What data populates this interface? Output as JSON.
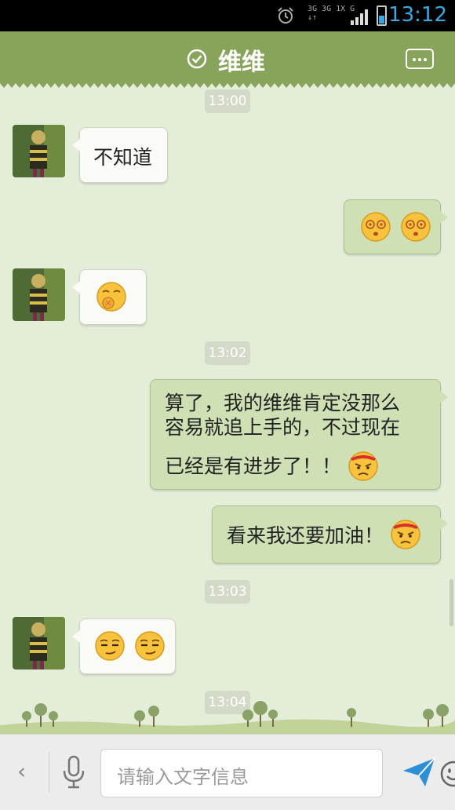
{
  "status_bar": {
    "time": "13:12",
    "network_line1": "3G 3G 1X G",
    "network_line2": "↓↑  ",
    "accent": "#37a9e0"
  },
  "header": {
    "title": "维维",
    "check_icon": "check-circle-icon",
    "more_icon": "more-icon",
    "color": "#88a35a"
  },
  "messages": {
    "t1": "13:00",
    "m1_text": "不知道",
    "t2": "13:02",
    "m5_line1": "算了，我的维维肯定没那么",
    "m5_line2": "容易就追上手的，不过现在",
    "m5_line3": "已经是有进步了！！",
    "m6_text": "看来我还要加油！",
    "t3": "13:03",
    "t4": "13:04"
  },
  "input": {
    "placeholder": "请输入文字信息",
    "back_glyph": "‹"
  }
}
